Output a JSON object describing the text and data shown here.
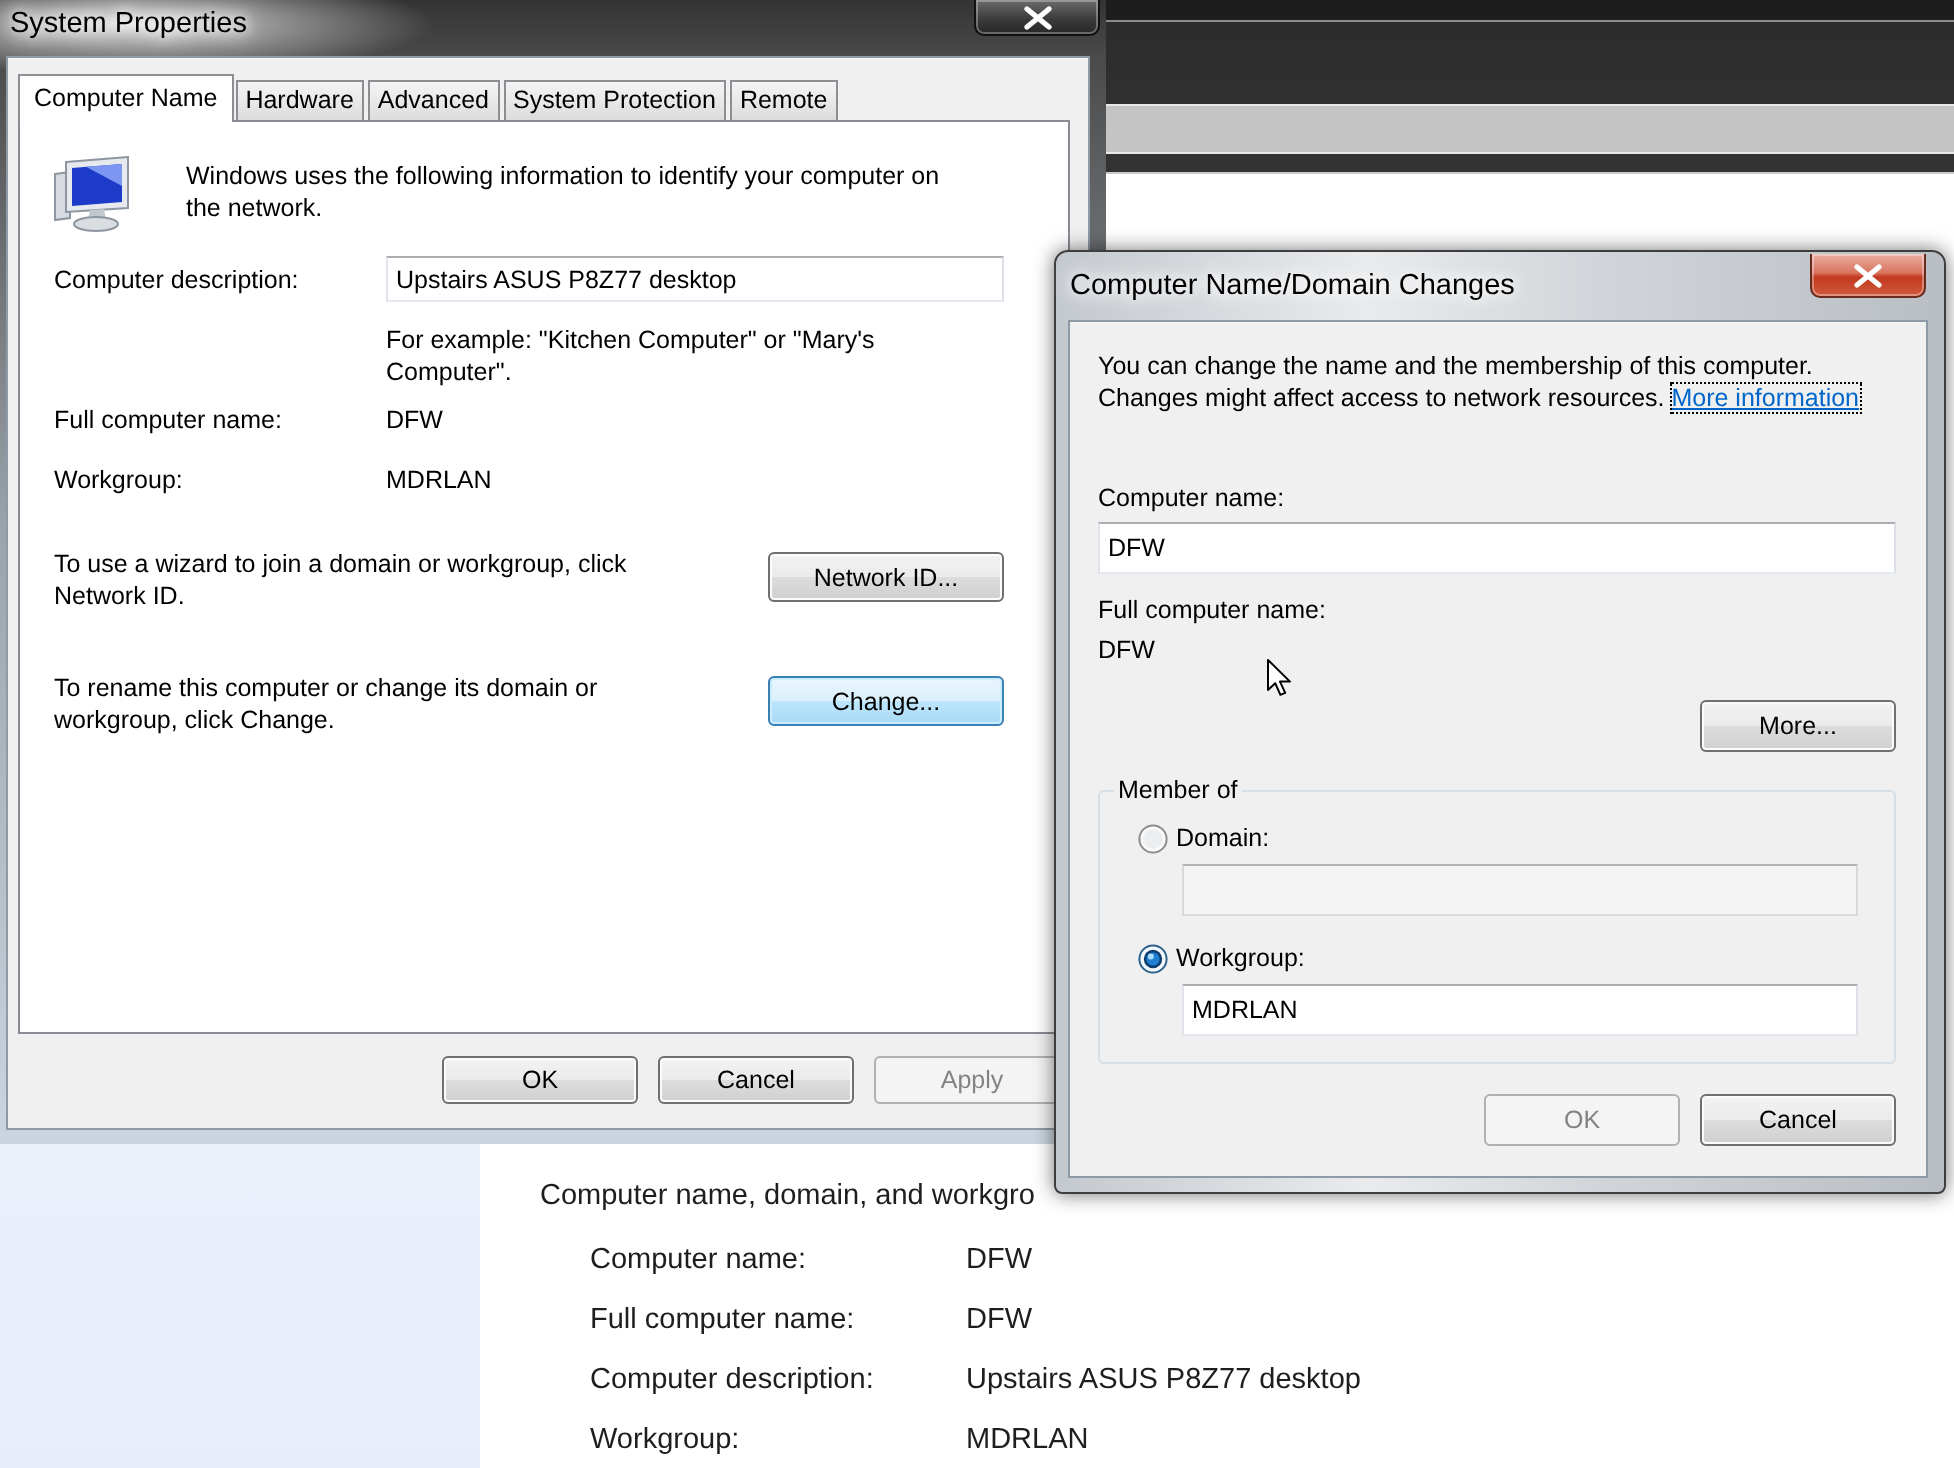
{
  "background_window": {
    "section_title": "Computer name, domain, and workgro",
    "rows": [
      {
        "label": "Computer name:",
        "value": "DFW"
      },
      {
        "label": "Full computer name:",
        "value": "DFW"
      },
      {
        "label": "Computer description:",
        "value": "Upstairs ASUS P8Z77 desktop"
      },
      {
        "label": "Workgroup:",
        "value": "MDRLAN"
      }
    ]
  },
  "system_properties": {
    "title": "System Properties",
    "tabs": [
      {
        "label": "Computer Name",
        "selected": true
      },
      {
        "label": "Hardware",
        "selected": false
      },
      {
        "label": "Advanced",
        "selected": false
      },
      {
        "label": "System Protection",
        "selected": false
      },
      {
        "label": "Remote",
        "selected": false
      }
    ],
    "intro": "Windows uses the following information to identify your computer on the network.",
    "description": {
      "label": "Computer description:",
      "value": "Upstairs ASUS P8Z77 desktop"
    },
    "example": "For example: \"Kitchen Computer\" or \"Mary's Computer\".",
    "info_rows": [
      {
        "label": "Full computer name:",
        "value": "DFW"
      },
      {
        "label": "Workgroup:",
        "value": "MDRLAN"
      }
    ],
    "actions": [
      {
        "text": "To use a wizard to join a domain or workgroup, click Network ID.",
        "button": "Network ID...",
        "highlighted": false
      },
      {
        "text": "To rename this computer or change its domain or workgroup, click Change.",
        "button": "Change...",
        "highlighted": true
      }
    ],
    "buttons": [
      {
        "label": "OK",
        "disabled": false
      },
      {
        "label": "Cancel",
        "disabled": false
      },
      {
        "label": "Apply",
        "disabled": true
      }
    ]
  },
  "name_changes_dialog": {
    "title": "Computer Name/Domain Changes",
    "message": "You can change the name and the membership of this computer. Changes might affect access to network resources.",
    "link": {
      "label": "More information",
      "focused": true
    },
    "computer_name": {
      "label": "Computer name:",
      "value": "DFW"
    },
    "full_computer_name": {
      "label": "Full computer name:",
      "value": "DFW"
    },
    "more_button": "More...",
    "member_of": {
      "title": "Member of",
      "options": [
        {
          "label": "Domain:",
          "selected": false,
          "disabled": true
        },
        {
          "label": "Workgroup:",
          "selected": true,
          "disabled": false,
          "value": "MDRLAN"
        }
      ]
    },
    "buttons": [
      {
        "label": "OK",
        "disabled": true
      },
      {
        "label": "Cancel",
        "disabled": false
      }
    ]
  }
}
